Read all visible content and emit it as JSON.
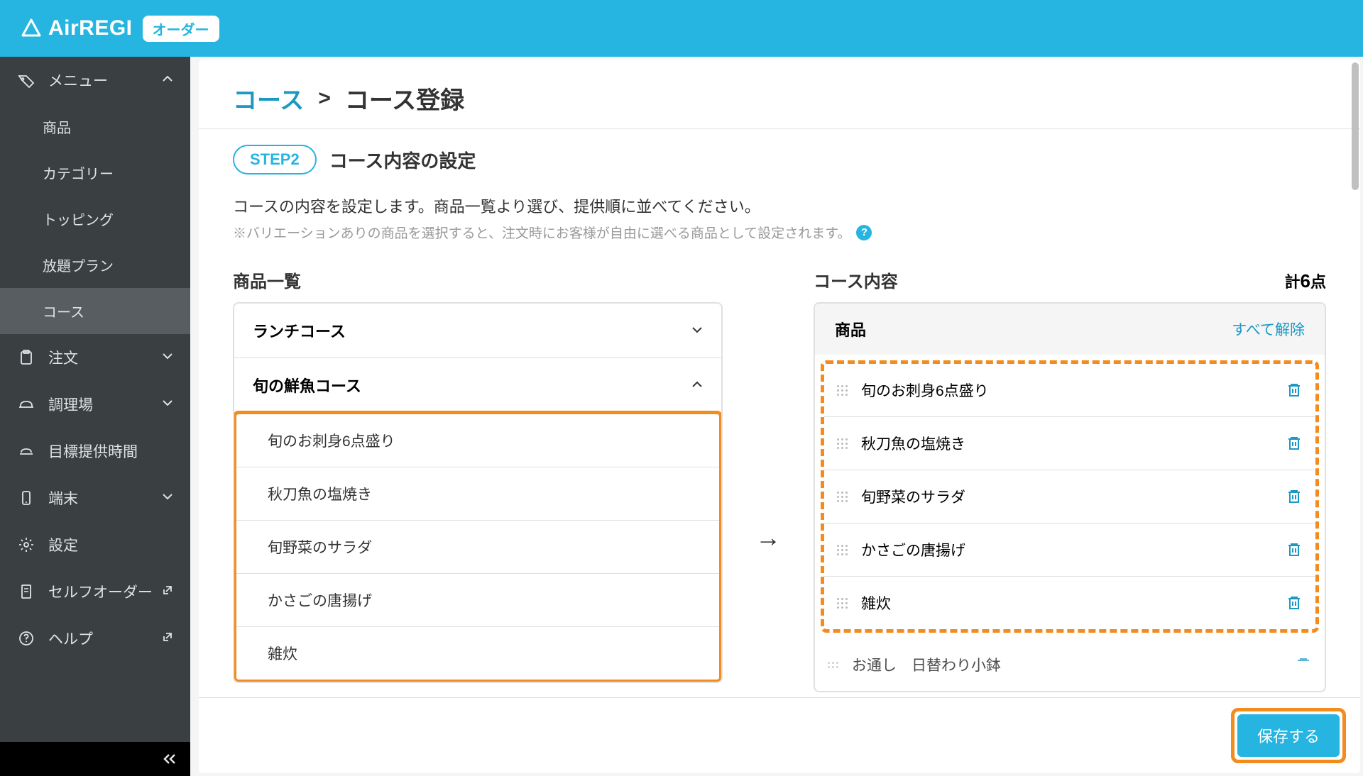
{
  "header": {
    "logo_text": "AirREGI",
    "badge": "オーダー"
  },
  "sidebar": {
    "menu": {
      "label": "メニュー",
      "items": [
        "商品",
        "カテゴリー",
        "トッピング",
        "放題プラン",
        "コース"
      ]
    },
    "others": [
      {
        "label": "注文"
      },
      {
        "label": "調理場"
      },
      {
        "label": "目標提供時間"
      },
      {
        "label": "端末"
      },
      {
        "label": "設定"
      },
      {
        "label": "セルフオーダー"
      },
      {
        "label": "ヘルプ"
      }
    ]
  },
  "breadcrumb": {
    "link": "コース",
    "sep": ">",
    "current": "コース登録"
  },
  "step": {
    "badge": "STEP2",
    "title": "コース内容の設定"
  },
  "description": "コースの内容を設定します。商品一覧より選び、提供順に並べてください。",
  "note": "※バリエーションありの商品を選択すると、注文時にお客様が自由に選べる商品として設定されます。",
  "product_list": {
    "label": "商品一覧",
    "categories": [
      {
        "name": "ランチコース",
        "expanded": false
      },
      {
        "name": "旬の鮮魚コース",
        "expanded": true,
        "items": [
          "旬のお刺身6点盛り",
          "秋刀魚の塩焼き",
          "旬野菜のサラダ",
          "かさごの唐揚げ",
          "雑炊"
        ]
      }
    ]
  },
  "course_content": {
    "label": "コース内容",
    "count_prefix": "計",
    "count_num": "6",
    "count_suffix": "点",
    "header_label": "商品",
    "clear_all": "すべて解除",
    "items": [
      "旬のお刺身6点盛り",
      "秋刀魚の塩焼き",
      "旬野菜のサラダ",
      "かさごの唐揚げ",
      "雑炊"
    ],
    "partial_item": "お通し　日替わり小鉢"
  },
  "arrow": "→",
  "save_label": "保存する"
}
